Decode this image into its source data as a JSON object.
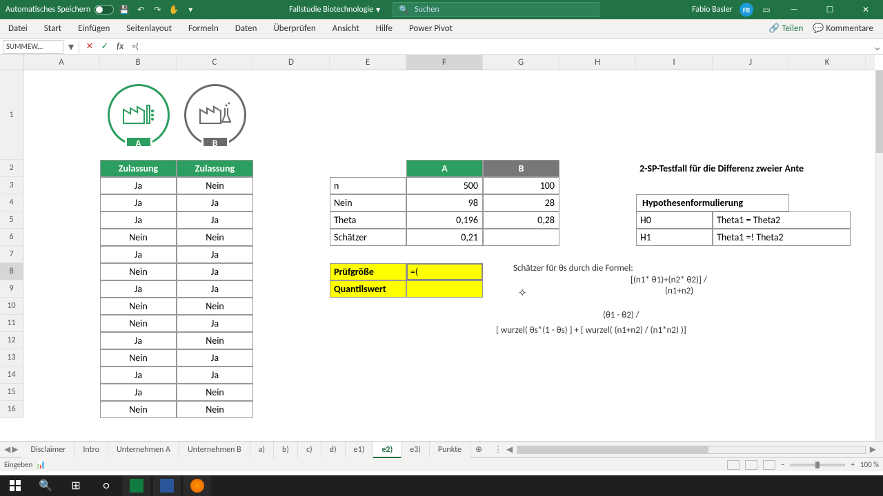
{
  "titlebar": {
    "autosave": "Automatisches Speichern",
    "doc": "Fallstudie Biotechnologie",
    "search_placeholder": "Suchen",
    "user": "Fabio Basler",
    "user_initials": "FB"
  },
  "ribbon": {
    "tabs": [
      "Datei",
      "Start",
      "Einfügen",
      "Seitenlayout",
      "Formeln",
      "Daten",
      "Überprüfen",
      "Ansicht",
      "Hilfe",
      "Power Pivot"
    ],
    "share": "Teilen",
    "comments": "Kommentare"
  },
  "formulabar": {
    "namebox": "SUMMEW...",
    "formula": "=("
  },
  "columns": [
    "A",
    "B",
    "C",
    "D",
    "E",
    "F",
    "G",
    "H",
    "I",
    "J",
    "K"
  ],
  "rows": [
    "1",
    "2",
    "3",
    "4",
    "5",
    "6",
    "7",
    "8",
    "9",
    "10",
    "11",
    "12",
    "13",
    "14",
    "15",
    "16"
  ],
  "headers": {
    "B2": "Zulassung",
    "C2": "Zulassung",
    "F2": "A",
    "G2": "B"
  },
  "tableBC": [
    [
      "Ja",
      "Nein"
    ],
    [
      "Ja",
      "Ja"
    ],
    [
      "Ja",
      "Ja"
    ],
    [
      "Nein",
      "Nein"
    ],
    [
      "Ja",
      "Ja"
    ],
    [
      "Nein",
      "Ja"
    ],
    [
      "Ja",
      "Ja"
    ],
    [
      "Nein",
      "Nein"
    ],
    [
      "Nein",
      "Ja"
    ],
    [
      "Ja",
      "Nein"
    ],
    [
      "Nein",
      "Ja"
    ],
    [
      "Ja",
      "Ja"
    ],
    [
      "Ja",
      "Nein"
    ],
    [
      "Nein",
      "Nein"
    ]
  ],
  "stats": {
    "E3": "n",
    "F3": "500",
    "G3": "100",
    "E4": "Nein",
    "F4": "98",
    "G4": "28",
    "E5": "Theta",
    "F5": "0,196",
    "G5": "0,28",
    "E6": "Schätzer",
    "F6": "0,21"
  },
  "pruef": {
    "E8": "Prüfgröße",
    "F8": "=(",
    "E9": "Quantilswert"
  },
  "right": {
    "I2": "2-SP-Testfall für die Differenz zweier Ante",
    "I4": "Hypothesenformulierung",
    "I5": "H0",
    "J5": "Theta1 = Theta2",
    "I6": "H1",
    "J6": "Theta1 =! Theta2"
  },
  "float": {
    "l1": "Schätzer für θs durch die Formel:",
    "l2": "[(n1* θ1)+(n2* θ2)] /",
    "l3": "(n1+n2)",
    "l4": "(θ1 - θ2) /",
    "l5": "[ wurzel( θs*(1 - θs) ] + [ wurzel( (n1+n2) / (n1*n2) )]"
  },
  "sheets": [
    "Disclaimer",
    "Intro",
    "Unternehmen A",
    "Unternehmen B",
    "a)",
    "b)",
    "c)",
    "d)",
    "e1)",
    "e2)",
    "e3)",
    "Punkte"
  ],
  "active_sheet": "e2)",
  "statusbar": {
    "mode": "Eingeben",
    "zoom": "100 %"
  },
  "factory": {
    "A": "A",
    "B": "B"
  }
}
